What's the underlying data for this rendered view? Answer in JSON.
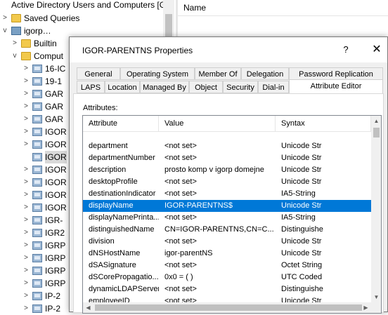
{
  "mmc": {
    "title": "Active Directory Users and Computers [G",
    "right_header": "Name",
    "tree": [
      {
        "label": "Saved Queries",
        "icon": "folder-icon",
        "indent": 0,
        "expand": ">"
      },
      {
        "label": "igorp…",
        "icon": "domain-icon",
        "indent": 0,
        "expand": "v"
      },
      {
        "label": "Builtin",
        "icon": "folder-icon",
        "indent": 1,
        "expand": ">"
      },
      {
        "label": "Comput",
        "icon": "folder-icon",
        "indent": 1,
        "expand": "v"
      },
      {
        "label": "16-IC",
        "icon": "computer-icon",
        "indent": 2,
        "expand": ">"
      },
      {
        "label": "19-1",
        "icon": "computer-icon",
        "indent": 2,
        "expand": ">"
      },
      {
        "label": "GAR",
        "icon": "computer-icon",
        "indent": 2,
        "expand": ">"
      },
      {
        "label": "GAR",
        "icon": "computer-icon",
        "indent": 2,
        "expand": ">"
      },
      {
        "label": "GAR",
        "icon": "computer-icon",
        "indent": 2,
        "expand": ">"
      },
      {
        "label": "IGOR",
        "icon": "computer-icon",
        "indent": 2,
        "expand": ">"
      },
      {
        "label": "IGOR",
        "icon": "computer-icon",
        "indent": 2,
        "expand": ">"
      },
      {
        "label": "IGOR",
        "icon": "computer-icon",
        "indent": 2,
        "expand": "",
        "selected": true
      },
      {
        "label": "IGOR",
        "icon": "computer-icon",
        "indent": 2,
        "expand": ">"
      },
      {
        "label": "IGOR",
        "icon": "computer-icon",
        "indent": 2,
        "expand": ">"
      },
      {
        "label": "IGOR",
        "icon": "computer-icon",
        "indent": 2,
        "expand": ">"
      },
      {
        "label": "IGOR",
        "icon": "computer-icon",
        "indent": 2,
        "expand": ">"
      },
      {
        "label": "IGR-",
        "icon": "computer-icon",
        "indent": 2,
        "expand": ">"
      },
      {
        "label": "IGR2",
        "icon": "computer-icon",
        "indent": 2,
        "expand": ">"
      },
      {
        "label": "IGRP",
        "icon": "computer-icon",
        "indent": 2,
        "expand": ">"
      },
      {
        "label": "IGRP",
        "icon": "computer-icon",
        "indent": 2,
        "expand": ">"
      },
      {
        "label": "IGRP",
        "icon": "computer-icon",
        "indent": 2,
        "expand": ">"
      },
      {
        "label": "IGRP",
        "icon": "computer-icon",
        "indent": 2,
        "expand": ">"
      },
      {
        "label": "IP-2",
        "icon": "computer-icon",
        "indent": 2,
        "expand": ">"
      },
      {
        "label": "IP-2",
        "icon": "computer-icon",
        "indent": 2,
        "expand": ">"
      }
    ]
  },
  "dialog": {
    "title": "IGOR-PARENTNS Properties",
    "help": "?",
    "close": "✕",
    "tabs_row1": [
      "General",
      "Operating System",
      "Member Of",
      "Delegation",
      "Password Replication"
    ],
    "tabs_row2": [
      "LAPS",
      "Location",
      "Managed By",
      "Object",
      "Security",
      "Dial-in",
      "Attribute Editor"
    ],
    "active_tab": "Attribute Editor",
    "attributes_label": "Attributes:",
    "columns": [
      "Attribute",
      "Value",
      "Syntax"
    ],
    "rows": [
      {
        "attribute": "department",
        "value": "<not set>",
        "syntax": "Unicode Str"
      },
      {
        "attribute": "departmentNumber",
        "value": "<not set>",
        "syntax": "Unicode Str"
      },
      {
        "attribute": "description",
        "value": "prosto komp v igorp domejne",
        "syntax": "Unicode Str"
      },
      {
        "attribute": "desktopProfile",
        "value": "<not set>",
        "syntax": "Unicode Str"
      },
      {
        "attribute": "destinationIndicator",
        "value": "<not set>",
        "syntax": "IA5-String"
      },
      {
        "attribute": "displayName",
        "value": "IGOR-PARENTNS$",
        "syntax": "Unicode Str",
        "selected": true
      },
      {
        "attribute": "displayNamePrinta...",
        "value": "<not set>",
        "syntax": "IA5-String"
      },
      {
        "attribute": "distinguishedName",
        "value": "CN=IGOR-PARENTNS,CN=C...",
        "syntax": "Distinguishe"
      },
      {
        "attribute": "division",
        "value": "<not set>",
        "syntax": "Unicode Str"
      },
      {
        "attribute": "dNSHostName",
        "value": "igor-parentNS",
        "syntax": "Unicode Str"
      },
      {
        "attribute": "dSASignature",
        "value": "<not set>",
        "syntax": "Octet String"
      },
      {
        "attribute": "dSCorePropagatio...",
        "value": "0x0 = ( )",
        "syntax": "UTC Coded"
      },
      {
        "attribute": "dynamicLDAPServer",
        "value": "<not set>",
        "syntax": "Distinguishe"
      },
      {
        "attribute": "employeeID",
        "value": "<not set>",
        "syntax": "Unicode Str"
      }
    ]
  }
}
